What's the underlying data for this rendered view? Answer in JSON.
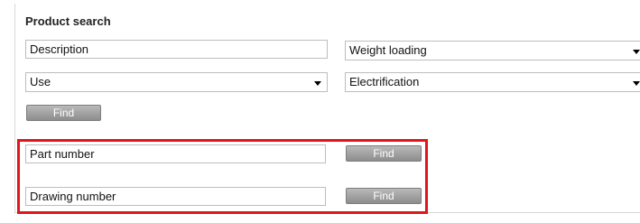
{
  "product_search": {
    "title": "Product search",
    "description_value": "Description",
    "weight_loading_value": "Weight loading",
    "use_value": "Use",
    "electrification_value": "Electrification",
    "find_label": "Find"
  },
  "part_number": {
    "value": "Part number",
    "find_label": "Find"
  },
  "drawing_number": {
    "value": "Drawing number",
    "find_label": "Find"
  },
  "colors": {
    "highlight": "#e0161b",
    "button": "#9e9e9e"
  }
}
